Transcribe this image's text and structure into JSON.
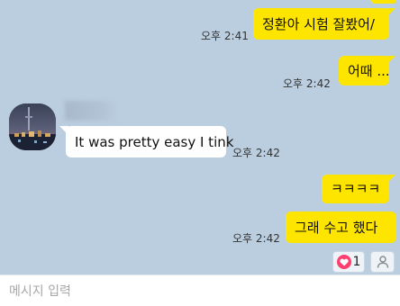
{
  "messages": [
    {
      "direction": "out",
      "text": "정환아 시험 잘봤어/",
      "time": "오후 2:41"
    },
    {
      "direction": "out",
      "text": "어때 ...",
      "time": "오후 2:42"
    },
    {
      "direction": "in",
      "text": "It was pretty easy I tink",
      "time": "오후 2:42"
    },
    {
      "direction": "out",
      "text": "ㅋㅋㅋㅋ",
      "time": ""
    },
    {
      "direction": "out",
      "text": "그래 수고 했다",
      "time": "오후 2:42"
    }
  ],
  "reactions": {
    "heart_count": "1"
  },
  "input": {
    "placeholder": "메시지 입력"
  },
  "colors": {
    "background": "#bacee0",
    "outgoing_bubble": "#fee500",
    "incoming_bubble": "#ffffff",
    "heart": "#ff3d6e"
  },
  "icons": {
    "reaction": "heart-icon",
    "profile": "person-icon"
  }
}
